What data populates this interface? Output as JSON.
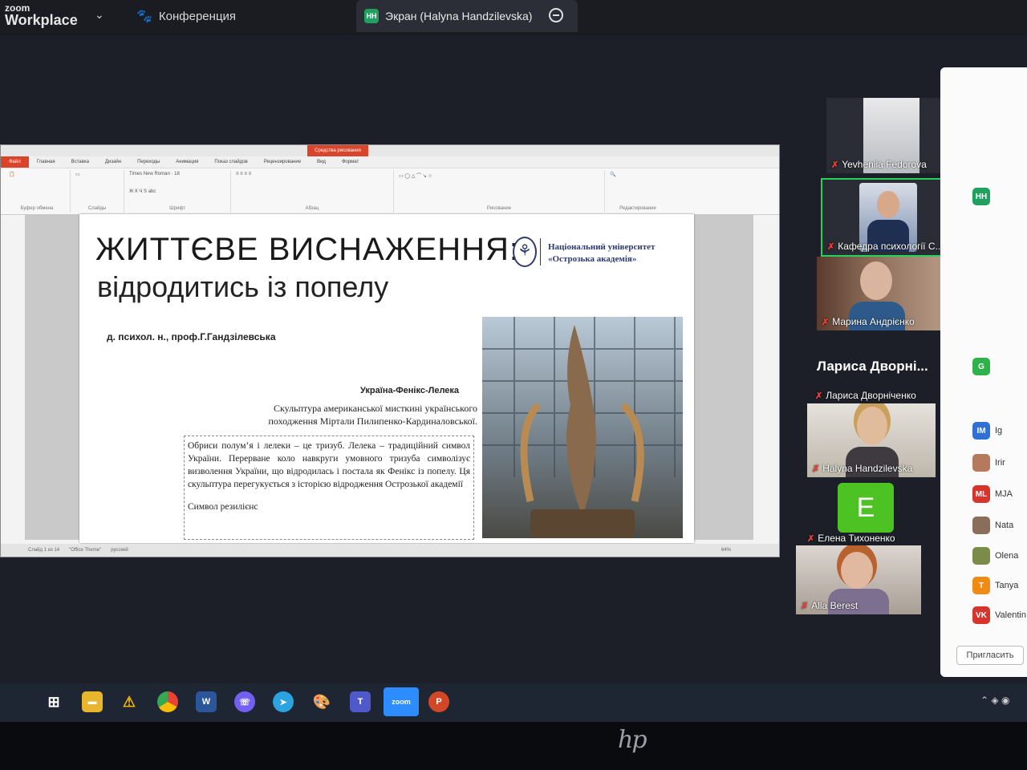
{
  "zoom": {
    "brand_line1": "zoom",
    "brand_line2": "Workplace",
    "meeting_label": "Конференция",
    "screen_tab_badge": "HH",
    "screen_tab_label": "Экран (Halyna Handzilevska)"
  },
  "ppt": {
    "context_tab": "Средства рисования",
    "tabs": [
      "Файл",
      "Главная",
      "Вставка",
      "Дизайн",
      "Переходы",
      "Анимация",
      "Показ слайдов",
      "Рецензирование",
      "Вид",
      "Формат"
    ],
    "ribbon_groups": [
      "Буфер обмена",
      "Слайды",
      "Шрифт",
      "Абзац",
      "Рисование",
      "Редактирование"
    ],
    "font_name": "Times New Roman",
    "font_size": "18",
    "status_slide": "Слайд 1 из 14",
    "status_theme": "\"Office Theme\"",
    "status_lang": "русский",
    "zoom_level": "64%"
  },
  "slide": {
    "title_line1": "ЖИТТЄВЕ ВИСНАЖЕННЯ:",
    "title_line2": "відродитись із попелу",
    "university_line1": "Національний університет",
    "university_line2": "«Острозька академія»",
    "author": "д. психол. н., проф.Г.Гандзілевська",
    "caption_title": "Україна-Фенікс-Лелека",
    "caption_text": "Скульптура американської мисткині українського походження Міртали Пилипенко-Кардиналовської.",
    "body_text": "Обриси полум’я і лелеки – це тризуб. Лелека – традиційний символ України. Перерване коло навкруги умовного тризуба символізує визволення України, що відродилась і постала як Фенікс із попелу. Ця скульптура перегукується з історією відродження Острозької академії",
    "symbol_text": "Символ резилієнс"
  },
  "gallery": {
    "tiles": [
      {
        "name": "Yevheniia Fedorova"
      },
      {
        "name": "Кафедра психології С..."
      },
      {
        "name": "Марина Андрієнко"
      },
      {
        "name": "Лариса Дворніченко"
      },
      {
        "name": "Halyna Handzilevska"
      },
      {
        "name": "Елена Тихоненко"
      },
      {
        "name": "Alla Berest"
      }
    ],
    "big_name": "Лариса Дворні...",
    "e_letter": "E"
  },
  "participants": {
    "rows": [
      {
        "initials": "HH",
        "name": "",
        "color": "#22a060"
      },
      {
        "initials": "G",
        "name": "",
        "color": "#2fb24c"
      },
      {
        "initials": "IM",
        "name": "Ig",
        "color": "#2f6fd6"
      },
      {
        "initials": "",
        "name": "Irir",
        "color": "#b57a5e"
      },
      {
        "initials": "ML",
        "name": "MJA",
        "color": "#d9342b"
      },
      {
        "initials": "",
        "name": "Nata",
        "color": "#8a6d5a"
      },
      {
        "initials": "",
        "name": "Olena",
        "color": "#7b8b4a"
      },
      {
        "initials": "T",
        "name": "Tanya",
        "color": "#f08a12"
      },
      {
        "initials": "VK",
        "name": "Valentin",
        "color": "#d9342b"
      }
    ],
    "invite_label": "Пригласить"
  },
  "taskbar": {
    "zoom_label": "zoom",
    "word_label": "W",
    "ppt_label": "P"
  },
  "bezel": {
    "logo": "hp"
  }
}
